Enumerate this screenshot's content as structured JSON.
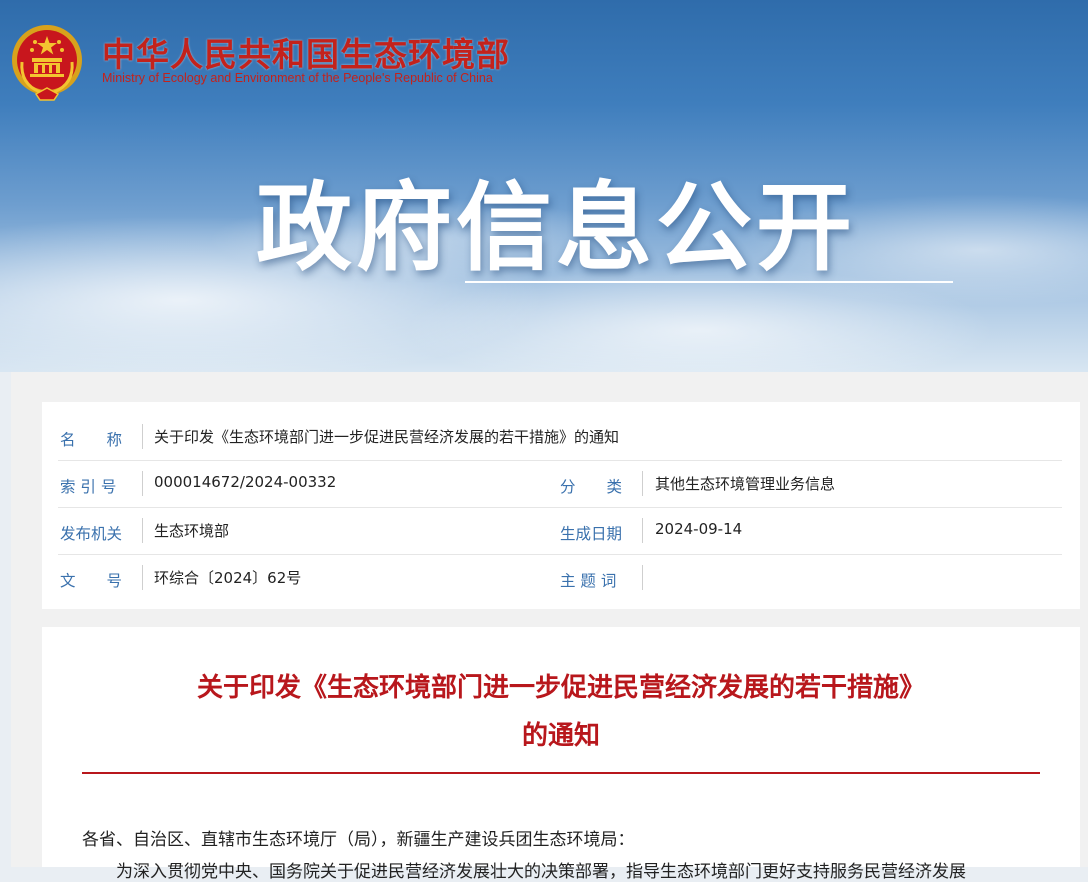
{
  "header": {
    "ministry_name_cn": "中华人民共和国生态环境部",
    "ministry_name_en": "Ministry of Ecology and Environment of the People's Republic of China",
    "section_title": "政府信息公开",
    "emblem_icon": "national-emblem-icon"
  },
  "meta": {
    "name_label": "名　　称",
    "name_value": "关于印发《生态环境部门进一步促进民营经济发展的若干措施》的通知",
    "index_label": "索 引 号",
    "index_value": "000014672/2024-00332",
    "category_label": "分　　类",
    "category_value": "其他生态环境管理业务信息",
    "issuer_label": "发布机关",
    "issuer_value": "生态环境部",
    "date_label": "生成日期",
    "date_value": "2024-09-14",
    "docno_label": "文　　号",
    "docno_value": "环综合〔2024〕62号",
    "subject_label": "主 题 词",
    "subject_value": ""
  },
  "article": {
    "title_line1": "关于印发《生态环境部门进一步促进民营经济发展的若干措施》",
    "title_line2": "的通知",
    "salutation": "各省、自治区、直辖市生态环境厅（局），新疆生产建设兵团生态环境局：",
    "first_line": "为深入贯彻党中央、国务院关于促进民营经济发展壮大的决策部署，指导生态环境部门更好支持服务民营经济发展"
  },
  "colors": {
    "brand_red": "#c3221c",
    "title_red": "#b8171c",
    "label_blue": "#3a71ad"
  }
}
